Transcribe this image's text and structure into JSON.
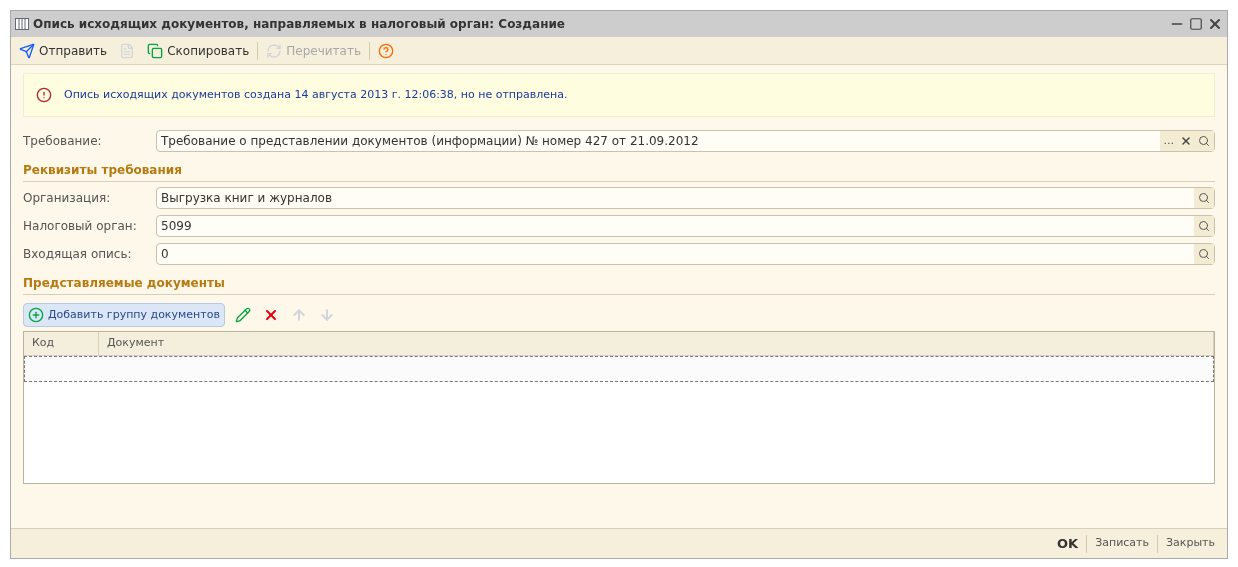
{
  "window": {
    "title": "Опись исходящих документов, направляемых в налоговый орган: Создание"
  },
  "toolbar": [
    {
      "kind": "send",
      "label": "Отправить",
      "disabled": false
    },
    {
      "kind": "icon",
      "disabled": true
    },
    {
      "kind": "copy",
      "label": "Скопировать",
      "disabled": false
    },
    {
      "kind": "reread",
      "label": "Перечитать",
      "disabled": true
    },
    {
      "kind": "help",
      "disabled": false
    }
  ],
  "notice": "Опись исходящих документов создана 14 августа 2013 г. 12:06:38, но не отправлена.",
  "requirement": {
    "label": "Требование:",
    "value": "Требование о представлении документов (информации) № номер 427 от 21.09.2012",
    "select_button": "..."
  },
  "requirement_details": {
    "title": "Реквизиты требования",
    "fields": [
      {
        "label": "Организация:",
        "value": "Выгрузка книг и журналов"
      },
      {
        "label": "Налоговый орган:",
        "value": "5099"
      },
      {
        "label": "Входящая опись:",
        "value": "0"
      }
    ]
  },
  "documents": {
    "title": "Представляемые документы",
    "add_button": "Добавить группу документов",
    "actions": [
      {
        "kind": "edit",
        "disabled": false
      },
      {
        "kind": "delete",
        "disabled": false
      },
      {
        "kind": "up",
        "disabled": true
      },
      {
        "kind": "down",
        "disabled": true
      }
    ],
    "columns": [
      "Код",
      "Документ"
    ],
    "rows": [
      {
        "selected": true
      }
    ]
  },
  "footer_buttons": [
    {
      "label": "OK",
      "default": true
    },
    {
      "label": "Записать",
      "default": false
    },
    {
      "label": "Закрыть",
      "default": false
    }
  ]
}
